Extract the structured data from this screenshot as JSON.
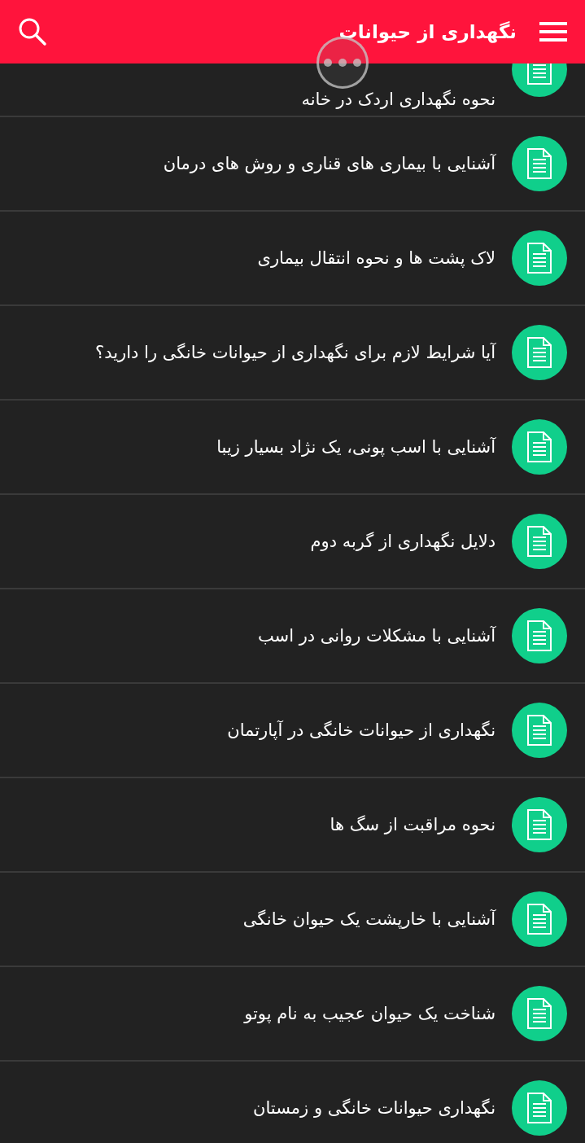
{
  "app_bar": {
    "title": "نگهداری از حیوانات"
  },
  "articles": [
    {
      "title": "نحوه نگهداری اردک در خانه"
    },
    {
      "title": "آشنایی با بیماری های قناری و روش های درمان"
    },
    {
      "title": "لاک پشت ها و نحوه انتقال بیماری"
    },
    {
      "title": "آیا شرایط لازم برای نگهداری از حیوانات خانگی را دارید؟"
    },
    {
      "title": "آشنایی با اسب پونی، یک نژاد بسیار زیبا"
    },
    {
      "title": "دلایل نگهداری از گربه دوم"
    },
    {
      "title": "آشنایی با مشکلات روانی در اسب"
    },
    {
      "title": "نگهداری از حیوانات خانگی در آپارتمان"
    },
    {
      "title": "نحوه مراقبت از سگ ها"
    },
    {
      "title": "آشنایی با خارپشت یک حیوان خانگی"
    },
    {
      "title": "شناخت یک حیوان عجیب به نام پوتو"
    },
    {
      "title": "نگهداری حیوانات خانگی و زمستان"
    }
  ]
}
